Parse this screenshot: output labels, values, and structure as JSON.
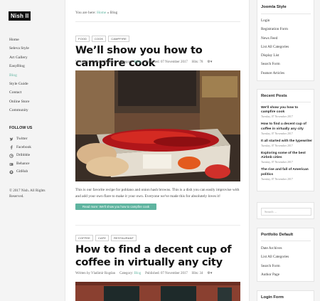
{
  "logo": "Nish II",
  "sidebar": {
    "menu": [
      "Home",
      "Seleva Style",
      "Art Gallery",
      "EasyBlog",
      "Blog",
      "Style Guide",
      "Contact",
      "Online Store",
      "Community"
    ],
    "active_index": 4,
    "follow_title": "FOLLOW US",
    "social": [
      {
        "label": "Twitter",
        "icon": "twitter-icon"
      },
      {
        "label": "Facebook",
        "icon": "facebook-icon"
      },
      {
        "label": "Dribbble",
        "icon": "dribbble-icon"
      },
      {
        "label": "Behance",
        "icon": "behance-icon"
      },
      {
        "label": "GitHub",
        "icon": "github-icon"
      }
    ],
    "copyright": "© 2017 Nish. All Rights Reserved."
  },
  "breadcrumb": {
    "prefix": "You are here:",
    "home": "Home",
    "separator": "»",
    "current": "Blog"
  },
  "articles": [
    {
      "tags": [
        "FOOD",
        "COOK",
        "CAMPFIRE"
      ],
      "title": "We’ll show you how to campfire cook",
      "author": "Written by Vladimir Rogdan",
      "category_prefix": "Category:",
      "category": "Blog",
      "published": "Published: 07 November 2017",
      "hits": "Hits: 78",
      "excerpt": "This is our favorite recipe for poblano and onion hash browns. This is a dish you can easily improvise with and add your own flare to make it your own. Everyone we've made this for absolutely loves it!",
      "read_more": "Read more: We’ll show you how to campfire cook"
    },
    {
      "tags": [
        "COFFEE",
        "CAFE",
        "RESTAURANT"
      ],
      "title": "How to find a decent cup of coffee in virtually any city",
      "author": "Written by Vladimir Rogdan",
      "category_prefix": "Category:",
      "category": "Blog",
      "published": "Published: 07 November 2017",
      "hits": "Hits: 34"
    }
  ],
  "right": {
    "joomla": {
      "title": "Joomla Style",
      "items": [
        "Login",
        "Registration Form",
        "News Feed",
        "List All Categories",
        "Display List",
        "Search Form",
        "Feature Articles"
      ]
    },
    "recent": {
      "title": "Recent Posts",
      "posts": [
        {
          "title": "We'll show you how to campfire cook",
          "date": "Tuesday, 07 November 2017"
        },
        {
          "title": "How to find a decent cup of coffee in virtually any city",
          "date": "Tuesday, 07 November 2017"
        },
        {
          "title": "It all started with the typewriter",
          "date": "Tuesday, 07 November 2017"
        },
        {
          "title": "Exploring some of the best Airbnb cities",
          "date": "Tuesday, 07 November 2017"
        },
        {
          "title": "The rise and fall of American politics",
          "date": "Tuesday, 07 November 2017"
        }
      ]
    },
    "search": {
      "placeholder": "Search ..."
    },
    "portfolio": {
      "title": "Portfolio Default",
      "items": [
        "Date Archives",
        "List All Categories",
        "Search Form",
        "Author Page"
      ]
    },
    "login": {
      "title": "Login Form"
    }
  },
  "colors": {
    "accent": "#5fb4a0",
    "text": "#333333",
    "sidebar_bg": "#f4f4f4"
  }
}
